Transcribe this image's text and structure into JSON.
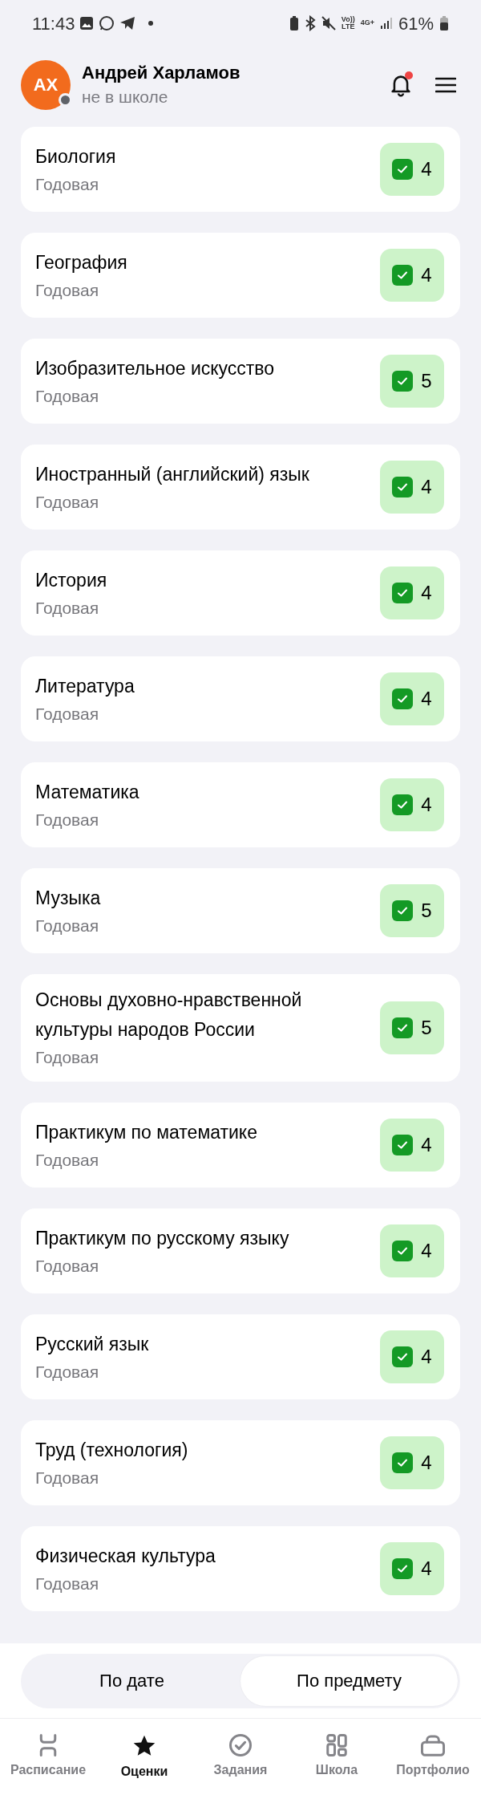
{
  "status_bar": {
    "time": "11:43",
    "volte_top": "Vo))",
    "volte_bottom": "LTE",
    "network": "4G+",
    "battery": "61%"
  },
  "header": {
    "avatar_initials": "АХ",
    "name": "Андрей Харламов",
    "status": "не в школе",
    "notification_unread": true
  },
  "subjects": [
    {
      "name": "Биология",
      "period": "Годовая",
      "grade": "4"
    },
    {
      "name": "География",
      "period": "Годовая",
      "grade": "4"
    },
    {
      "name": "Изобразительное искусство",
      "period": "Годовая",
      "grade": "5"
    },
    {
      "name": "Иностранный (английский) язык",
      "period": "Годовая",
      "grade": "4"
    },
    {
      "name": "История",
      "period": "Годовая",
      "grade": "4"
    },
    {
      "name": "Литература",
      "period": "Годовая",
      "grade": "4"
    },
    {
      "name": "Математика",
      "period": "Годовая",
      "grade": "4"
    },
    {
      "name": "Музыка",
      "period": "Годовая",
      "grade": "5"
    },
    {
      "name": "Основы духовно-нравственной культуры народов России",
      "period": "Годовая",
      "grade": "5"
    },
    {
      "name": "Практикум по математике",
      "period": "Годовая",
      "grade": "4"
    },
    {
      "name": "Практикум по русскому языку",
      "period": "Годовая",
      "grade": "4"
    },
    {
      "name": "Русский язык",
      "period": "Годовая",
      "grade": "4"
    },
    {
      "name": "Труд (технология)",
      "period": "Годовая",
      "grade": "4"
    },
    {
      "name": "Физическая культура",
      "period": "Годовая",
      "grade": "4"
    }
  ],
  "sort_toggle": [
    {
      "label": "По дате",
      "selected": false
    },
    {
      "label": "По предмету",
      "selected": true
    }
  ],
  "bottom_nav": [
    {
      "kind": "schedule",
      "label": "Расписание",
      "selected": false
    },
    {
      "kind": "grades",
      "label": "Оценки",
      "selected": true
    },
    {
      "kind": "tasks",
      "label": "Задания",
      "selected": false
    },
    {
      "kind": "school",
      "label": "Школа",
      "selected": false
    },
    {
      "kind": "portfolio",
      "label": "Портфолио",
      "selected": false
    }
  ]
}
